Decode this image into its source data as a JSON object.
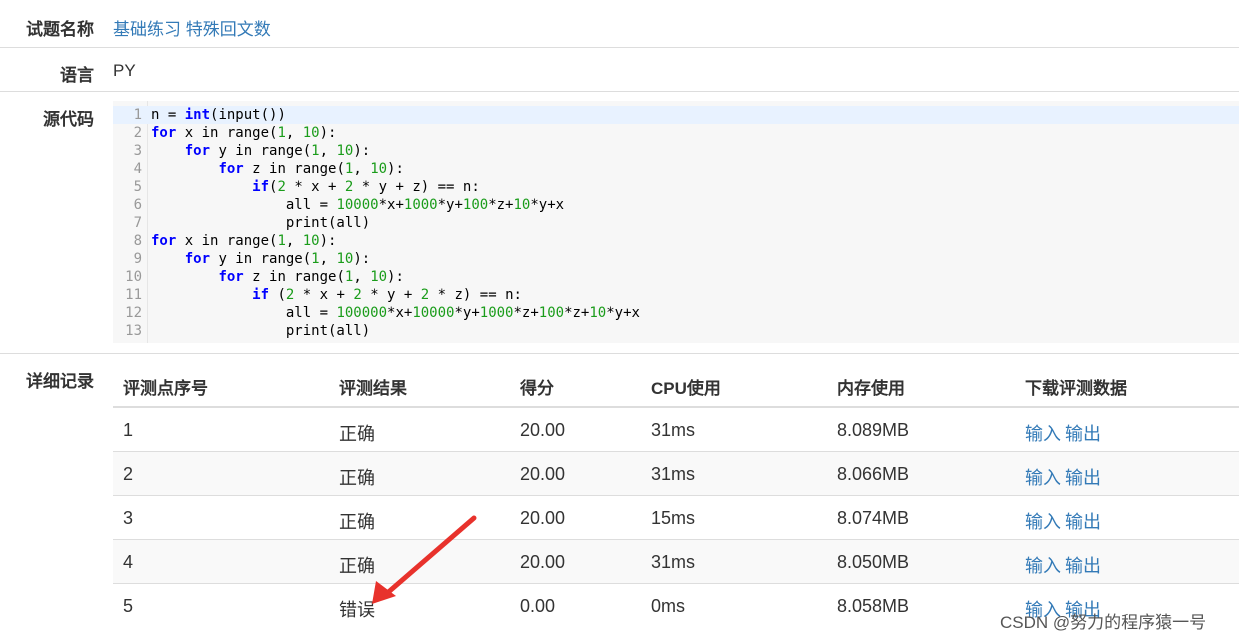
{
  "problem": {
    "label": "试题名称",
    "value": "基础练习 特殊回文数"
  },
  "language": {
    "label": "语言",
    "value": "PY"
  },
  "source": {
    "label": "源代码",
    "lines": [
      {
        "num": "1",
        "code": [
          [
            "n = ",
            ""
          ],
          [
            "int",
            "kw"
          ],
          [
            "(input())",
            ""
          ]
        ]
      },
      {
        "num": "2",
        "code": [
          [
            "for",
            "kw"
          ],
          [
            " x in range(",
            ""
          ],
          [
            "1",
            "n"
          ],
          [
            ", ",
            ""
          ],
          [
            "10",
            "n"
          ],
          [
            "):",
            ""
          ]
        ]
      },
      {
        "num": "3",
        "code": [
          [
            "    ",
            ""
          ],
          [
            "for",
            "kw"
          ],
          [
            " y in range(",
            ""
          ],
          [
            "1",
            "n"
          ],
          [
            ", ",
            ""
          ],
          [
            "10",
            "n"
          ],
          [
            "):",
            ""
          ]
        ]
      },
      {
        "num": "4",
        "code": [
          [
            "        ",
            ""
          ],
          [
            "for",
            "kw"
          ],
          [
            " z in range(",
            ""
          ],
          [
            "1",
            "n"
          ],
          [
            ", ",
            ""
          ],
          [
            "10",
            "n"
          ],
          [
            "):",
            ""
          ]
        ]
      },
      {
        "num": "5",
        "code": [
          [
            "            ",
            ""
          ],
          [
            "if",
            "kw"
          ],
          [
            "(",
            ""
          ],
          [
            "2",
            "n"
          ],
          [
            " * x + ",
            ""
          ],
          [
            "2",
            "n"
          ],
          [
            " * y + z) == n:",
            ""
          ]
        ]
      },
      {
        "num": "6",
        "code": [
          [
            "                all = ",
            ""
          ],
          [
            "10000",
            "n"
          ],
          [
            "*x+",
            ""
          ],
          [
            "1000",
            "n"
          ],
          [
            "*y+",
            ""
          ],
          [
            "100",
            "n"
          ],
          [
            "*z+",
            ""
          ],
          [
            "10",
            "n"
          ],
          [
            "*y+x",
            ""
          ]
        ]
      },
      {
        "num": "7",
        "code": [
          [
            "                print(all)",
            ""
          ]
        ]
      },
      {
        "num": "8",
        "code": [
          [
            "for",
            "kw"
          ],
          [
            " x in range(",
            ""
          ],
          [
            "1",
            "n"
          ],
          [
            ", ",
            ""
          ],
          [
            "10",
            "n"
          ],
          [
            "):",
            ""
          ]
        ]
      },
      {
        "num": "9",
        "code": [
          [
            "    ",
            ""
          ],
          [
            "for",
            "kw"
          ],
          [
            " y in range(",
            ""
          ],
          [
            "1",
            "n"
          ],
          [
            ", ",
            ""
          ],
          [
            "10",
            "n"
          ],
          [
            "):",
            ""
          ]
        ]
      },
      {
        "num": "10",
        "code": [
          [
            "        ",
            ""
          ],
          [
            "for",
            "kw"
          ],
          [
            " z in range(",
            ""
          ],
          [
            "1",
            "n"
          ],
          [
            ", ",
            ""
          ],
          [
            "10",
            "n"
          ],
          [
            "):",
            ""
          ]
        ]
      },
      {
        "num": "11",
        "code": [
          [
            "            ",
            ""
          ],
          [
            "if",
            "kw"
          ],
          [
            " (",
            ""
          ],
          [
            "2",
            "n"
          ],
          [
            " * x + ",
            ""
          ],
          [
            "2",
            "n"
          ],
          [
            " * y + ",
            ""
          ],
          [
            "2",
            "n"
          ],
          [
            " * z) == n:",
            ""
          ]
        ]
      },
      {
        "num": "12",
        "code": [
          [
            "                all = ",
            ""
          ],
          [
            "100000",
            "n"
          ],
          [
            "*x+",
            ""
          ],
          [
            "10000",
            "n"
          ],
          [
            "*y+",
            ""
          ],
          [
            "1000",
            "n"
          ],
          [
            "*z+",
            ""
          ],
          [
            "100",
            "n"
          ],
          [
            "*z+",
            ""
          ],
          [
            "10",
            "n"
          ],
          [
            "*y+x",
            ""
          ]
        ]
      },
      {
        "num": "13",
        "code": [
          [
            "                print(all)",
            ""
          ]
        ]
      }
    ]
  },
  "details": {
    "label": "详细记录",
    "headers": [
      "评测点序号",
      "评测结果",
      "得分",
      "CPU使用",
      "内存使用",
      "下载评测数据"
    ],
    "rows": [
      {
        "id": "1",
        "result": "正确",
        "score": "20.00",
        "cpu": "31ms",
        "mem": "8.089MB",
        "input": "输入",
        "output": "输出"
      },
      {
        "id": "2",
        "result": "正确",
        "score": "20.00",
        "cpu": "31ms",
        "mem": "8.066MB",
        "input": "输入",
        "output": "输出"
      },
      {
        "id": "3",
        "result": "正确",
        "score": "20.00",
        "cpu": "15ms",
        "mem": "8.074MB",
        "input": "输入",
        "output": "输出"
      },
      {
        "id": "4",
        "result": "正确",
        "score": "20.00",
        "cpu": "31ms",
        "mem": "8.050MB",
        "input": "输入",
        "output": "输出"
      },
      {
        "id": "5",
        "result": "错误",
        "score": "0.00",
        "cpu": "0ms",
        "mem": "8.058MB",
        "input": "输入",
        "output": "输出"
      }
    ]
  },
  "colors": {
    "link": "#337ab7",
    "keyword": "#0000ff",
    "number": "#1a9c1a",
    "arrow": "#e8322c"
  },
  "watermark": "CSDN @努力的程序猿一号"
}
